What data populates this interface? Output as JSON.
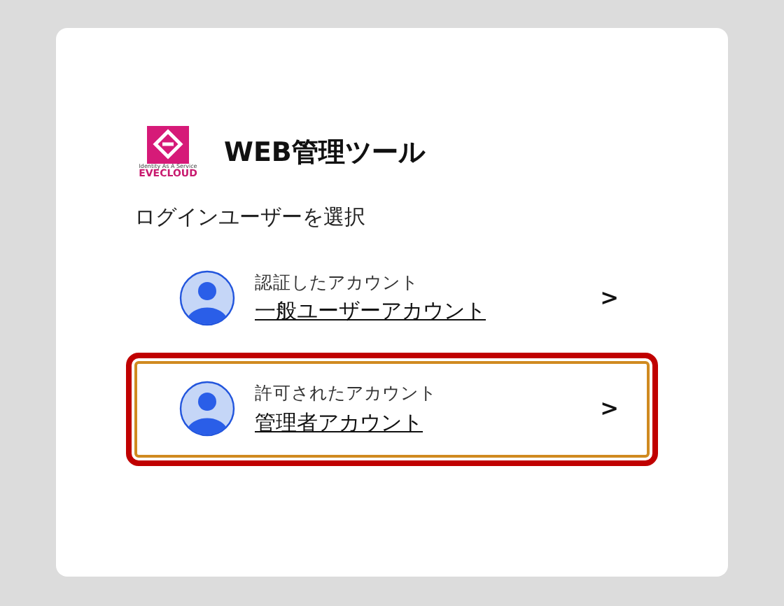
{
  "logo": {
    "tagline": "Identity As A Service",
    "name": "EVECLOUD"
  },
  "title": "WEB管理ツール",
  "prompt": "ログインユーザーを選択",
  "accounts": [
    {
      "caption": "認証したアカウント",
      "name": "一般ユーザーアカウント",
      "chevron": ">",
      "selected": false
    },
    {
      "caption": "許可されたアカウント",
      "name": "管理者アカウント",
      "chevron": ">",
      "selected": true
    }
  ]
}
